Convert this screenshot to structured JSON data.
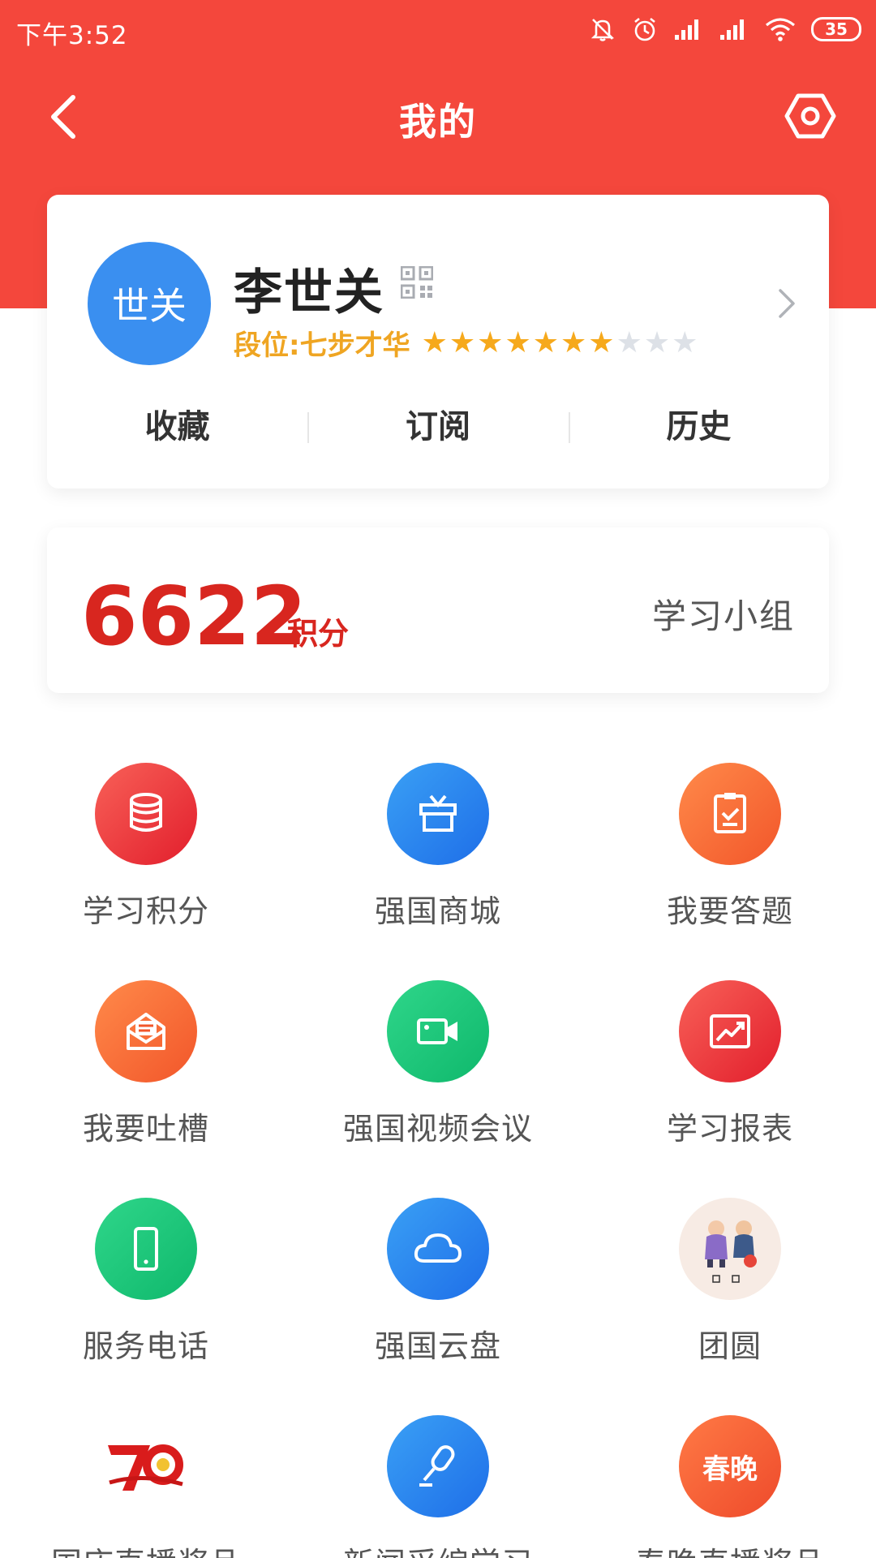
{
  "status_bar": {
    "time": "下午3:52",
    "battery": "35"
  },
  "header": {
    "title": "我的"
  },
  "profile": {
    "avatar_text": "世关",
    "name": "李世关",
    "rank": "段位:七步才华",
    "stars_filled": 7,
    "stars_total": 10,
    "tabs": [
      {
        "label": "收藏"
      },
      {
        "label": "订阅"
      },
      {
        "label": "历史"
      }
    ]
  },
  "points": {
    "value": "6622",
    "unit": "积分",
    "study_group": "学习小组"
  },
  "grid": [
    {
      "label": "学习积分",
      "icon": "database-icon"
    },
    {
      "label": "强国商城",
      "icon": "gift-icon"
    },
    {
      "label": "我要答题",
      "icon": "clipboard-check-icon"
    },
    {
      "label": "我要吐槽",
      "icon": "mail-open-icon"
    },
    {
      "label": "强国视频会议",
      "icon": "video-camera-icon"
    },
    {
      "label": "学习报表",
      "icon": "chart-trend-icon"
    },
    {
      "label": "服务电话",
      "icon": "phone-icon"
    },
    {
      "label": "强国云盘",
      "icon": "cloud-icon"
    },
    {
      "label": "团圆",
      "icon": "family-illustration-icon"
    },
    {
      "label": "国庆直播奖品",
      "icon": "anniversary-70-icon"
    },
    {
      "label": "新闻采编学习",
      "icon": "microphone-icon"
    },
    {
      "label": "春晚直播奖品",
      "icon": "spring-gala-icon",
      "badge": "春晚"
    }
  ],
  "colors": {
    "header_red": "#f4473c",
    "points_red": "#d8261f",
    "star_gold": "#f6a91c",
    "rank_gold": "#efa522"
  }
}
